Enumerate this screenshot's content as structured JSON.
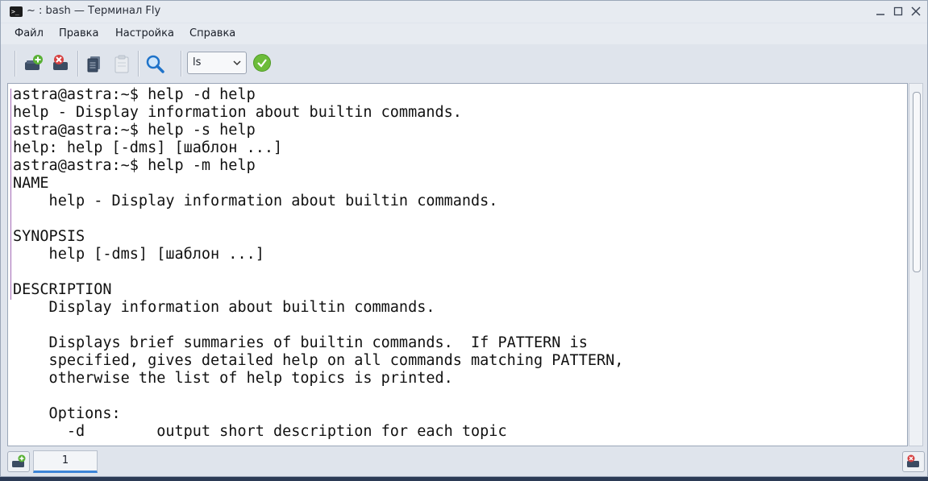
{
  "window": {
    "title": "~ : bash — Терминал Fly",
    "icon_name": "terminal-icon",
    "controls": [
      "minimize",
      "maximize",
      "close"
    ]
  },
  "menu": {
    "items": [
      {
        "label": "Файл"
      },
      {
        "label": "Правка"
      },
      {
        "label": "Настройка"
      },
      {
        "label": "Справка"
      }
    ]
  },
  "toolbar": {
    "buttons": [
      "new-tab-icon",
      "close-tab-icon",
      "copy-icon",
      "paste-icon",
      "find-icon"
    ],
    "command_select": {
      "value": "ls"
    },
    "run_icon": "checkmark-icon"
  },
  "terminal": {
    "lines": [
      "astra@astra:~$ help -d help",
      "help - Display information about builtin commands.",
      "astra@astra:~$ help -s help",
      "help: help [-dms] [шаблон ...]",
      "astra@astra:~$ help -m help",
      "NAME",
      "    help - Display information about builtin commands.",
      "",
      "SYNOPSIS",
      "    help [-dms] [шаблон ...]",
      "",
      "DESCRIPTION",
      "    Display information about builtin commands.",
      "",
      "    Displays brief summaries of builtin commands.  If PATTERN is",
      "    specified, gives detailed help on all commands matching PATTERN,",
      "    otherwise the list of help topics is printed.",
      "",
      "    Options:",
      "      -d        output short description for each topic"
    ]
  },
  "tabs": {
    "items": [
      {
        "label": "1",
        "active": true
      }
    ]
  },
  "colors": {
    "accent": "#3c84d7",
    "run_green": "#6cbc3a",
    "terminal_bg": "#ffffff"
  }
}
